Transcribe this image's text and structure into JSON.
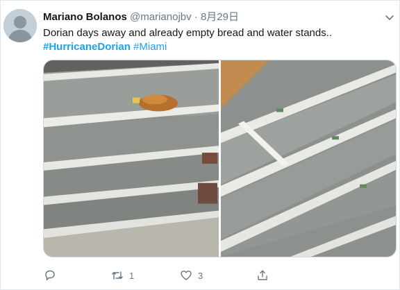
{
  "tweet": {
    "display_name": "Mariano Bolanos",
    "handle": "@marianojbv",
    "separator": "·",
    "timestamp": "8月29日",
    "text": "Dorian days away and already empty bread and water stands..",
    "hashtags": [
      "#HurricaneDorian",
      "#Miami"
    ]
  },
  "media": {
    "photos": [
      {
        "subject": "empty grocery shelves with a single bag of bread"
      },
      {
        "subject": "empty grocery shelves viewed from above"
      }
    ]
  },
  "actions": {
    "reply": {
      "icon": "reply-icon",
      "count": ""
    },
    "retweet": {
      "icon": "retweet-icon",
      "count": "1"
    },
    "like": {
      "icon": "heart-icon",
      "count": "3"
    },
    "share": {
      "icon": "share-icon",
      "count": ""
    }
  },
  "colors": {
    "link": "#1da1f2",
    "secondary_text": "#657786",
    "primary_text": "#14171a"
  }
}
